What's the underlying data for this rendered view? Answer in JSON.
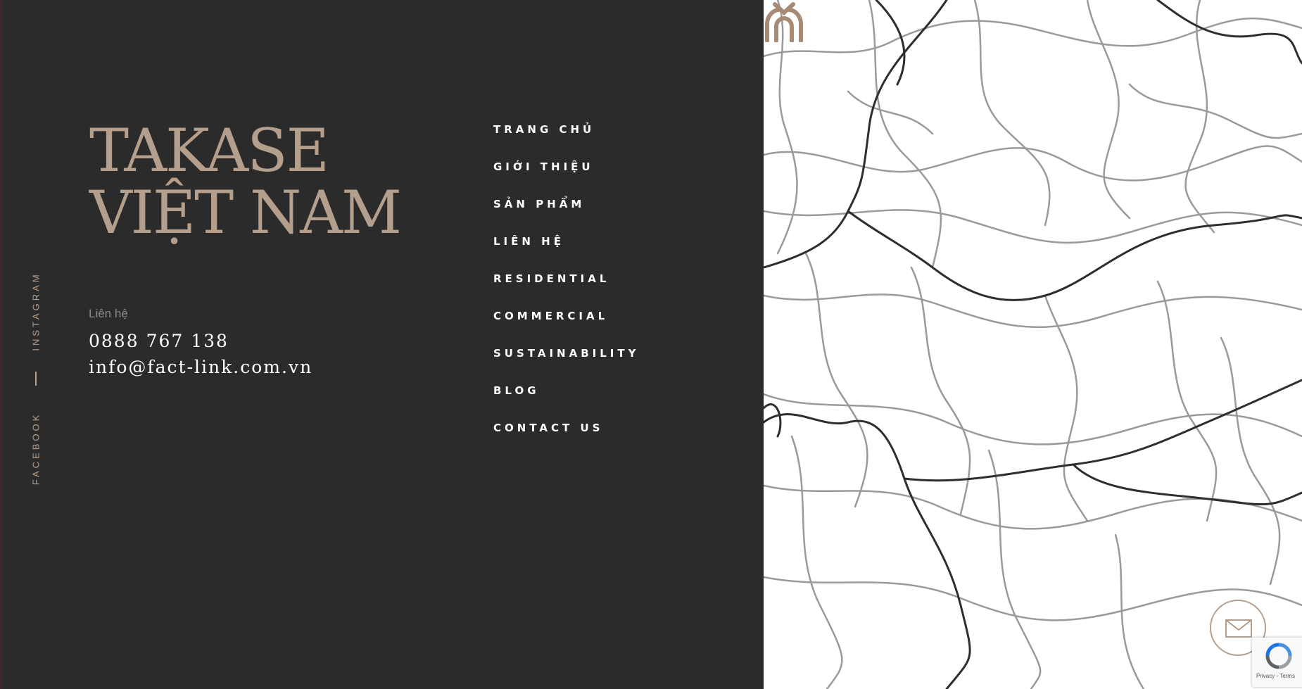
{
  "social": {
    "instagram": "INSTAGRAM",
    "facebook": "FACEBOOK"
  },
  "brand": {
    "line1": "TAKASE",
    "line2": "VIỆT NAM"
  },
  "contact": {
    "label": "Liên hệ",
    "phone": "0888 767 138",
    "email": "info@fact-link.com.vn"
  },
  "nav": [
    {
      "label": "TRANG CHỦ"
    },
    {
      "label": "GIỚI THIỆU"
    },
    {
      "label": "SẢN PHẨM"
    },
    {
      "label": "LIÊN HỆ"
    },
    {
      "label": "RESIDENTIAL"
    },
    {
      "label": "COMMERCIAL"
    },
    {
      "label": "SUSTAINABILITY"
    },
    {
      "label": "BLOG"
    },
    {
      "label": "CONTACT US"
    }
  ],
  "recaptcha": {
    "terms": "Privacy - Terms"
  },
  "icons": {
    "marker": "takase-logo-icon",
    "mail": "mail-icon",
    "recaptcha": "recaptcha-icon"
  },
  "colors": {
    "accent": "#b49e8c",
    "panel": "#2b2b2b",
    "map_bg": "#ffffff"
  }
}
